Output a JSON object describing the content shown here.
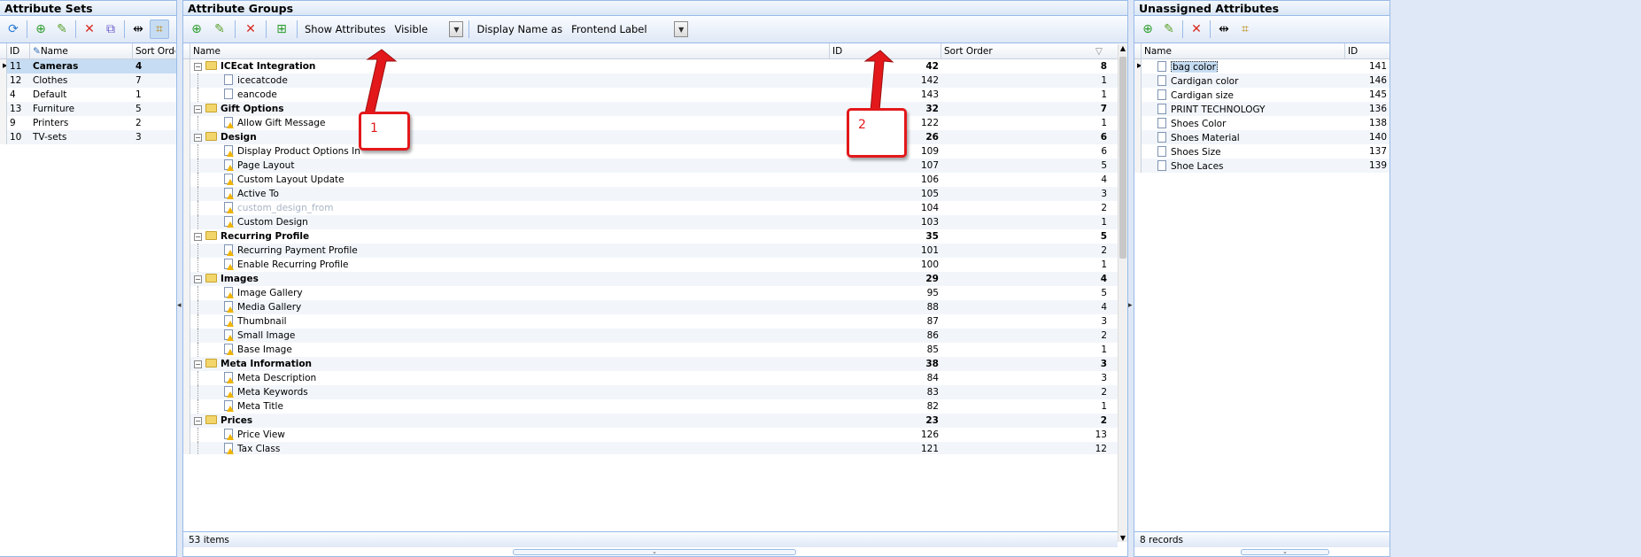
{
  "left_panel": {
    "title": "Attribute Sets",
    "columns": [
      "ID",
      "Name",
      "Sort Order"
    ],
    "rows": [
      {
        "id": "11",
        "name": "Cameras",
        "sort": "4",
        "selected": true
      },
      {
        "id": "12",
        "name": "Clothes",
        "sort": "7"
      },
      {
        "id": "4",
        "name": "Default",
        "sort": "1"
      },
      {
        "id": "13",
        "name": "Furniture",
        "sort": "5"
      },
      {
        "id": "9",
        "name": "Printers",
        "sort": "2"
      },
      {
        "id": "10",
        "name": "TV-sets",
        "sort": "3"
      }
    ]
  },
  "center_panel": {
    "title": "Attribute Groups",
    "show_attributes_label": "Show Attributes",
    "show_attributes_value": "Visible",
    "display_name_label": "Display Name as",
    "display_name_value": "Frontend Label",
    "columns": [
      "Name",
      "ID",
      "Sort Order"
    ],
    "rows": [
      {
        "type": "group",
        "name": "ICEcat Integration",
        "id": "42",
        "sort": "8"
      },
      {
        "type": "attr",
        "name": "icecatcode",
        "id": "142",
        "sort": "1"
      },
      {
        "type": "attr",
        "name": "eancode",
        "id": "143",
        "sort": "1"
      },
      {
        "type": "group",
        "name": "Gift Options",
        "id": "32",
        "sort": "7"
      },
      {
        "type": "attr",
        "name": "Allow Gift Message",
        "id": "122",
        "sort": "1",
        "warn": true
      },
      {
        "type": "group",
        "name": "Design",
        "id": "26",
        "sort": "6"
      },
      {
        "type": "attr",
        "name": "Display Product Options In",
        "id": "109",
        "sort": "6",
        "warn": true
      },
      {
        "type": "attr",
        "name": "Page Layout",
        "id": "107",
        "sort": "5",
        "warn": true
      },
      {
        "type": "attr",
        "name": "Custom Layout Update",
        "id": "106",
        "sort": "4",
        "warn": true
      },
      {
        "type": "attr",
        "name": "Active To",
        "id": "105",
        "sort": "3",
        "warn": true
      },
      {
        "type": "attr",
        "name": "custom_design_from",
        "id": "104",
        "sort": "2",
        "warn": true,
        "muted": true
      },
      {
        "type": "attr",
        "name": "Custom Design",
        "id": "103",
        "sort": "1",
        "warn": true
      },
      {
        "type": "group",
        "name": "Recurring Profile",
        "id": "35",
        "sort": "5"
      },
      {
        "type": "attr",
        "name": "Recurring Payment Profile",
        "id": "101",
        "sort": "2",
        "warn": true
      },
      {
        "type": "attr",
        "name": "Enable Recurring Profile",
        "id": "100",
        "sort": "1",
        "warn": true
      },
      {
        "type": "group",
        "name": "Images",
        "id": "29",
        "sort": "4"
      },
      {
        "type": "attr",
        "name": "Image Gallery",
        "id": "95",
        "sort": "5",
        "warn": true
      },
      {
        "type": "attr",
        "name": "Media Gallery",
        "id": "88",
        "sort": "4",
        "warn": true
      },
      {
        "type": "attr",
        "name": "Thumbnail",
        "id": "87",
        "sort": "3",
        "warn": true
      },
      {
        "type": "attr",
        "name": "Small Image",
        "id": "86",
        "sort": "2",
        "warn": true
      },
      {
        "type": "attr",
        "name": "Base Image",
        "id": "85",
        "sort": "1",
        "warn": true
      },
      {
        "type": "group",
        "name": "Meta Information",
        "id": "38",
        "sort": "3"
      },
      {
        "type": "attr",
        "name": "Meta Description",
        "id": "84",
        "sort": "3",
        "warn": true
      },
      {
        "type": "attr",
        "name": "Meta Keywords",
        "id": "83",
        "sort": "2",
        "warn": true
      },
      {
        "type": "attr",
        "name": "Meta Title",
        "id": "82",
        "sort": "1",
        "warn": true
      },
      {
        "type": "group",
        "name": "Prices",
        "id": "23",
        "sort": "2"
      },
      {
        "type": "attr",
        "name": "Price View",
        "id": "126",
        "sort": "13",
        "warn": true
      },
      {
        "type": "attr",
        "name": "Tax Class",
        "id": "121",
        "sort": "12",
        "warn": true
      }
    ],
    "footer": "53 items"
  },
  "right_panel": {
    "title": "Unassigned Attributes",
    "columns": [
      "Name",
      "ID"
    ],
    "rows": [
      {
        "name": "bag color",
        "id": "141",
        "selected": true
      },
      {
        "name": "Cardigan color",
        "id": "146"
      },
      {
        "name": "Cardigan size",
        "id": "145"
      },
      {
        "name": "PRINT TECHNOLOGY",
        "id": "136"
      },
      {
        "name": "Shoes Color",
        "id": "138"
      },
      {
        "name": "Shoes Material",
        "id": "140"
      },
      {
        "name": "Shoes Size",
        "id": "137"
      },
      {
        "name": "Shoe Laces",
        "id": "139"
      }
    ],
    "footer": "8 records"
  },
  "annotations": {
    "callout_1": "1",
    "callout_2": "2",
    "color": "#e3181b"
  }
}
